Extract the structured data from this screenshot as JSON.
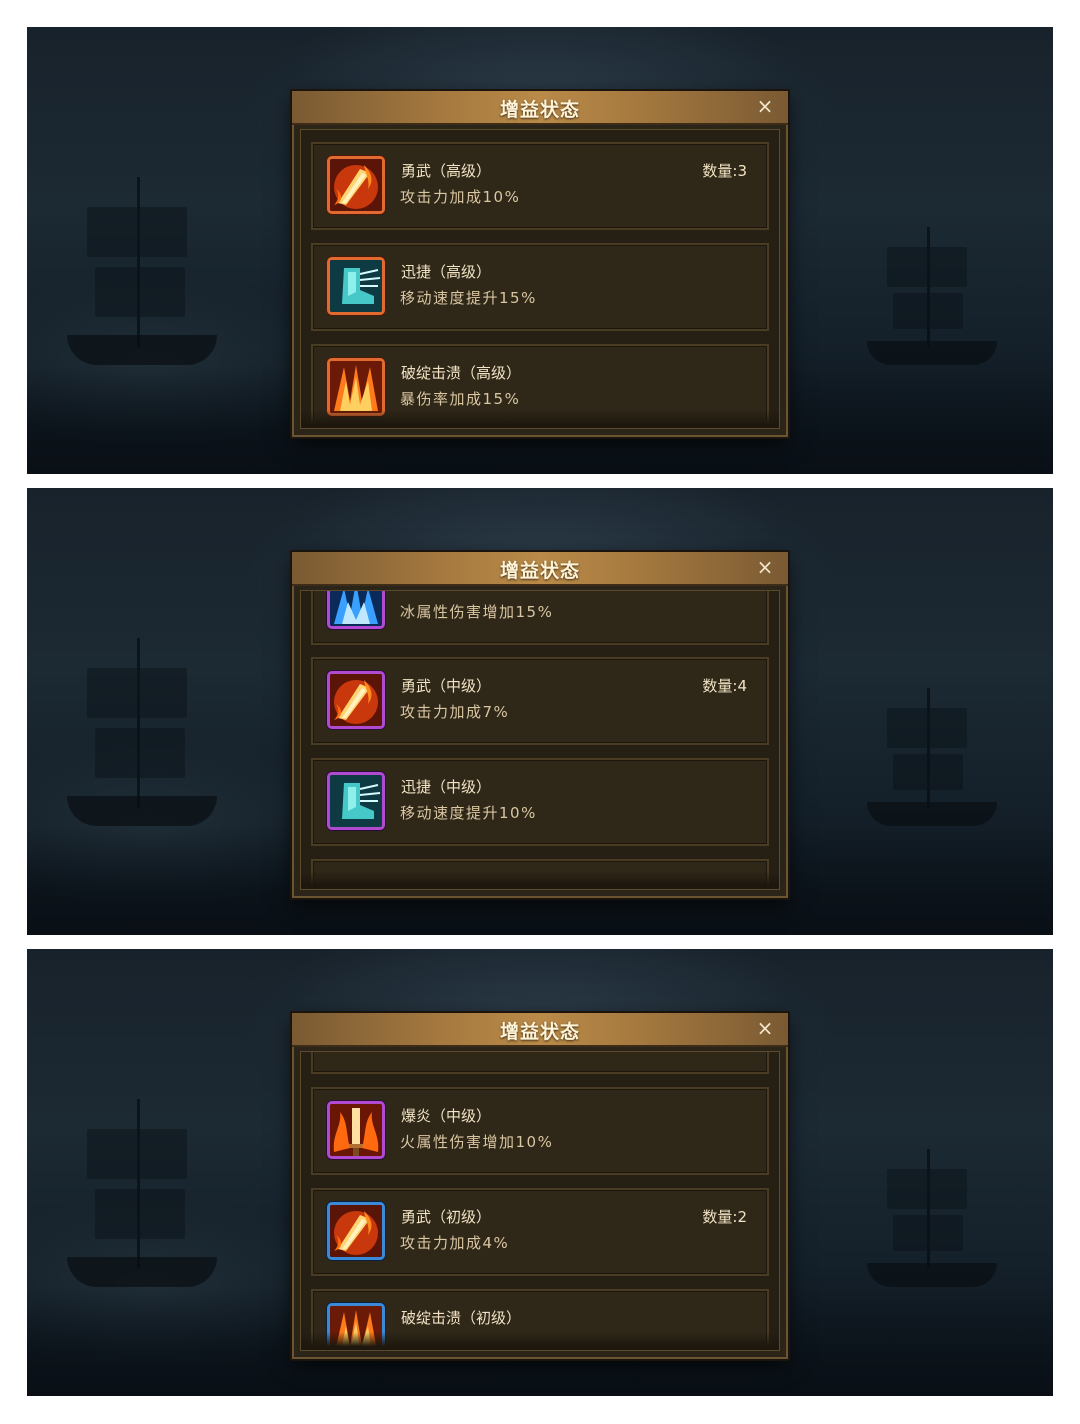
{
  "panels": [
    {
      "title": "增益状态",
      "close_label": "×",
      "buffs": [
        {
          "name": "勇武（高级）",
          "desc": "攻击力加成10%",
          "count": "数量:3",
          "icon": "flaming-sword-icon",
          "tier": "orange"
        },
        {
          "name": "迅捷（高级）",
          "desc": "移动速度提升15%",
          "count": "",
          "icon": "winged-boot-icon",
          "tier": "orange"
        },
        {
          "name": "破绽击溃（高级）",
          "desc": "暴伤率加成15%",
          "count": "",
          "icon": "fire-claw-icon",
          "tier": "orange"
        }
      ]
    },
    {
      "title": "增益状态",
      "close_label": "×",
      "buffs": [
        {
          "name": "",
          "desc": "冰属性伤害增加15%",
          "count": "",
          "icon": "ice-sword-icon",
          "tier": "purple"
        },
        {
          "name": "勇武（中级）",
          "desc": "攻击力加成7%",
          "count": "数量:4",
          "icon": "flaming-sword-icon",
          "tier": "purple"
        },
        {
          "name": "迅捷（中级）",
          "desc": "移动速度提升10%",
          "count": "",
          "icon": "winged-boot-icon",
          "tier": "purple"
        },
        {
          "name": "",
          "desc": "",
          "count": "",
          "icon": "",
          "tier": "purple"
        }
      ]
    },
    {
      "title": "增益状态",
      "close_label": "×",
      "buffs": [
        {
          "name": "",
          "desc": "",
          "count": "",
          "icon": "",
          "tier": "purple"
        },
        {
          "name": "爆炎（中级）",
          "desc": "火属性伤害增加10%",
          "count": "",
          "icon": "fire-sword-icon",
          "tier": "purple"
        },
        {
          "name": "勇武（初级）",
          "desc": "攻击力加成4%",
          "count": "数量:2",
          "icon": "flaming-sword-icon",
          "tier": "blue"
        },
        {
          "name": "破绽击溃（初级）",
          "desc": "",
          "count": "",
          "icon": "fire-claw-icon",
          "tier": "blue"
        }
      ]
    }
  ],
  "colors": {
    "orange_tier": "#e06a30",
    "purple_tier": "#b04ad0",
    "blue_tier": "#3a8ad8",
    "title_bar": "#a5793f"
  }
}
